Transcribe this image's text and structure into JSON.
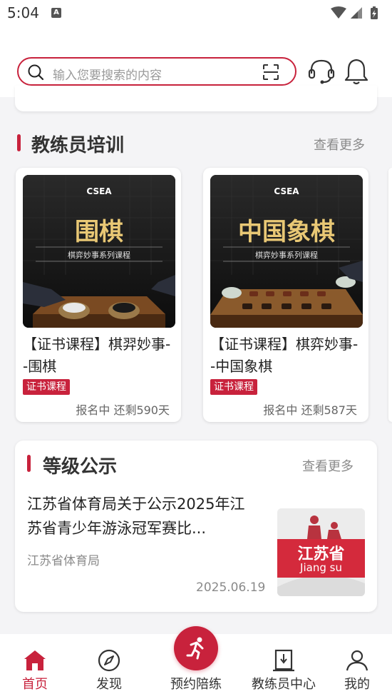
{
  "status_bar": {
    "time": "5:04",
    "notif_letter": "A"
  },
  "search": {
    "placeholder": "输入您要搜索的内容"
  },
  "icons": {
    "search": "search-icon",
    "scan": "scan-icon",
    "service": "headset-icon",
    "notify": "bell-icon"
  },
  "colors": {
    "accent": "#c8223c",
    "background": "#f4f4f6"
  },
  "coach_training": {
    "title": "教练员培训",
    "more": "查看更多",
    "courses": [
      {
        "img_logo": "CSEA",
        "img_title": "围棋",
        "img_subtitle": "棋弈妙事系列课程",
        "title": "【证书课程】棋羿妙事--围棋",
        "tag": "证书课程",
        "status": "报名中 还剩590天"
      },
      {
        "img_logo": "CSEA",
        "img_title": "中国象棋",
        "img_subtitle": "棋弈妙事系列课程",
        "title": "【证书课程】棋弈妙事--中国象棋",
        "tag": "证书课程",
        "status": "报名中 还剩587天"
      }
    ]
  },
  "level_notice": {
    "title": "等级公示",
    "more": "查看更多",
    "news": {
      "title": "江苏省体育局关于公示2025年江苏省青少年游泳冠军赛比...",
      "source": "江苏省体育局",
      "date": "2025.06.19",
      "thumb_text": "江苏省",
      "thumb_en": "Jiang su"
    }
  },
  "tabbar": {
    "items": [
      {
        "label": "首页",
        "icon": "home-icon",
        "active": true
      },
      {
        "label": "发现",
        "icon": "compass-icon",
        "active": false
      },
      {
        "label": "预约陪练",
        "icon": "runner-icon",
        "active": false
      },
      {
        "label": "教练员中心",
        "icon": "coach-center-icon",
        "active": false
      },
      {
        "label": "我的",
        "icon": "user-icon",
        "active": false
      }
    ]
  }
}
